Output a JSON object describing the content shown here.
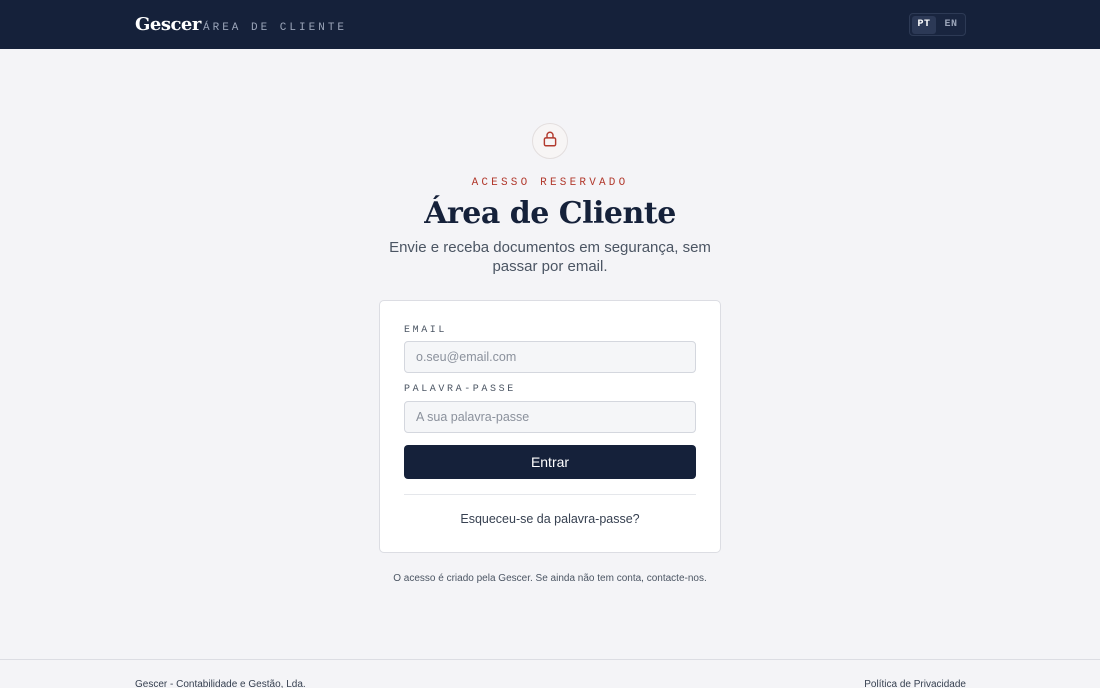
{
  "header": {
    "brand": "Gescer",
    "brand_sub": "ÁREA DE CLIENTE",
    "languages": [
      "PT",
      "EN"
    ],
    "active_language": "PT"
  },
  "hero": {
    "icon": "lock-icon",
    "eyebrow": "ACESSO RESERVADO",
    "title": "Área de Cliente",
    "subtitle": "Envie e receba documentos em segurança, sem passar por email."
  },
  "login_form": {
    "email_label": "EMAIL",
    "email_placeholder": "o.seu@email.com",
    "email_value": "",
    "password_label": "PALAVRA-PASSE",
    "password_placeholder": "A sua palavra-passe",
    "password_value": "",
    "submit_label": "Entrar",
    "forgot_link": "Esqueceu-se da palavra-passe?"
  },
  "access_note": "O acesso é criado pela Gescer. Se ainda não tem conta, contacte-nos.",
  "footer": {
    "company": "Gescer - Contabilidade e Gestão, Lda.",
    "privacy_link": "Política de Privacidade"
  },
  "colors": {
    "navy": "#15213a",
    "accent_red": "#b23a2e",
    "background": "#f4f4f7"
  }
}
